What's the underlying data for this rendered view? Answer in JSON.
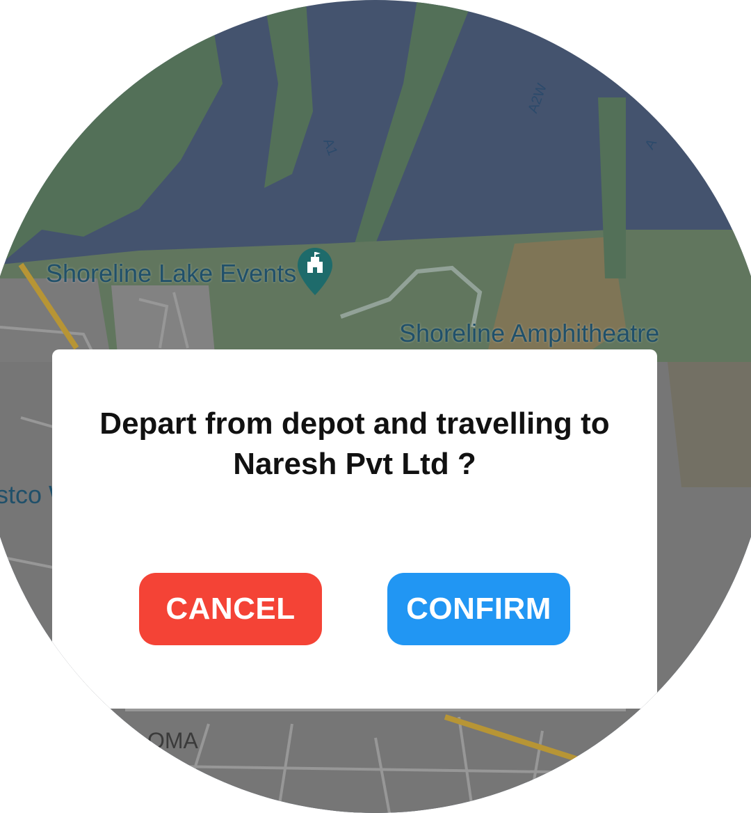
{
  "map": {
    "place_labels": {
      "lake_events": "Shoreline Lake Events",
      "amphitheatre": "Shoreline Amphitheatre",
      "costco_partial": "stco W",
      "loma_partial": "OMA"
    },
    "road_labels": {
      "a1": "A1",
      "a2w": "A2W",
      "a_partial": "A"
    },
    "pin_icon": "park-pin-icon"
  },
  "dialog": {
    "message": "Depart from depot and travelling to Naresh Pvt Ltd ?",
    "cancel_label": "CANCEL",
    "confirm_label": "CONFIRM"
  },
  "colors": {
    "cancel": "#f44336",
    "confirm": "#2196f3",
    "water": "#4a5b78",
    "land": "#5a7a5e",
    "urban": "#8a8a8a"
  }
}
